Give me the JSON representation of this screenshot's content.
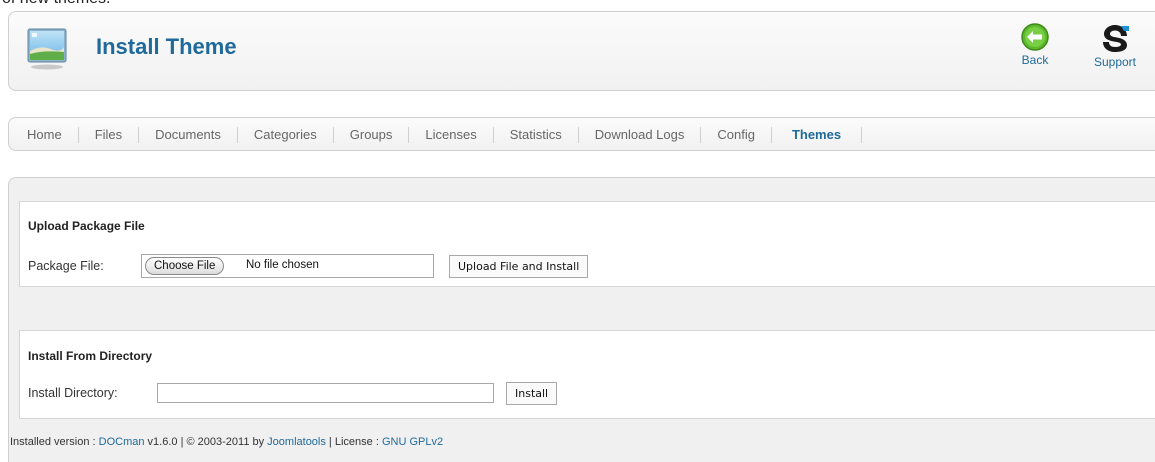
{
  "top_fragment": "of new themes.",
  "header": {
    "title": "Install Theme",
    "back_label": "Back",
    "support_label": "Support"
  },
  "nav": {
    "items": [
      {
        "label": "Home"
      },
      {
        "label": "Files"
      },
      {
        "label": "Documents"
      },
      {
        "label": "Categories"
      },
      {
        "label": "Groups"
      },
      {
        "label": "Licenses"
      },
      {
        "label": "Statistics"
      },
      {
        "label": "Download Logs"
      },
      {
        "label": "Config"
      },
      {
        "label": "Themes",
        "active": true
      }
    ]
  },
  "upload_panel": {
    "title": "Upload Package File",
    "field_label": "Package File:",
    "choose_button": "Choose File",
    "no_file_text": "No file chosen",
    "submit_label": "Upload File and Install"
  },
  "directory_panel": {
    "title": "Install From Directory",
    "field_label": "Install Directory:",
    "value": "",
    "submit_label": "Install"
  },
  "footer": {
    "prefix": "Installed version : ",
    "product_link": "DOCman",
    "version_text": " v1.6.0 | © 2003-2011 by ",
    "author_link": "Joomlatools",
    "license_text": " | License : ",
    "license_link": "GNU GPLv2"
  },
  "colors": {
    "accent": "#1f6a9b",
    "panel_bg": "#f0f0f0",
    "back_icon_green": "#5cb82c"
  },
  "icons": {
    "theme": "theme-screen-icon",
    "back": "back-arrow-icon",
    "support": "support-logo-icon"
  }
}
